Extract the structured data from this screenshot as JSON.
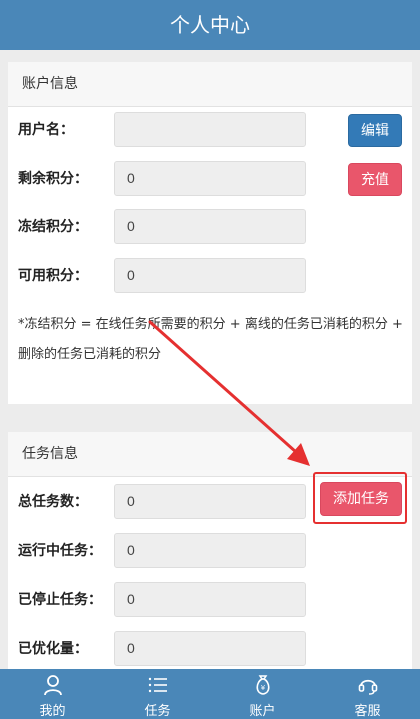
{
  "header": {
    "title": "个人中心"
  },
  "account": {
    "section_title": "账户信息",
    "username_label": "用户名：",
    "username_value": "",
    "remaining_label": "剩余积分：",
    "remaining_value": "0",
    "frozen_label": "冻结积分：",
    "frozen_value": "0",
    "available_label": "可用积分：",
    "available_value": "0",
    "edit_button": "编辑",
    "recharge_button": "充值",
    "note": "*冻结积分 = 在线任务所需要的积分 + 离线的任务已消耗的积分 + 删除的任务已消耗的积分"
  },
  "tasks": {
    "section_title": "任务信息",
    "total_label": "总任务数：",
    "total_value": "0",
    "running_label": "运行中任务：",
    "running_value": "0",
    "stopped_label": "已停止任务：",
    "stopped_value": "0",
    "optimized_label": "已优化量：",
    "optimized_value": "0",
    "add_button": "添加任务"
  },
  "colors": {
    "brand": "#4a87b8",
    "primary_button": "#337ab7",
    "danger_button": "#e9566b",
    "annotation": "#e53030"
  },
  "tabbar": {
    "items": [
      {
        "label": "我的",
        "icon": "user-icon"
      },
      {
        "label": "任务",
        "icon": "list-icon"
      },
      {
        "label": "账户",
        "icon": "money-bag-icon"
      },
      {
        "label": "客服",
        "icon": "headset-icon"
      }
    ]
  }
}
